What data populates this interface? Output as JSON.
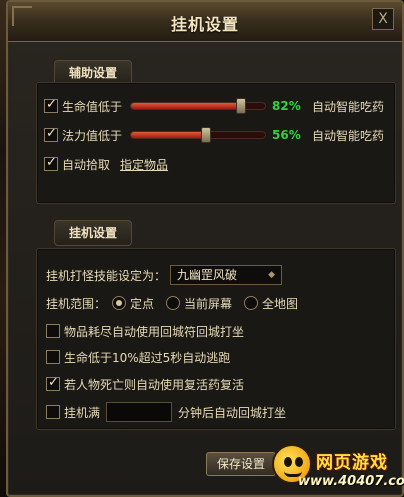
{
  "window": {
    "title": "挂机设置",
    "close_label": "X"
  },
  "assist": {
    "section_label": "辅助设置",
    "hp": {
      "label": "生命值低于",
      "checked": true,
      "value_text": "82%",
      "value": 0.82,
      "auto_text": "自动智能吃药"
    },
    "mp": {
      "label": "法力值低于",
      "checked": true,
      "value_text": "56%",
      "value": 0.56,
      "auto_text": "自动智能吃药"
    },
    "pickup": {
      "label": "自动拾取",
      "checked": true,
      "link": "指定物品"
    }
  },
  "hang": {
    "section_label": "挂机设置",
    "skill_label": "挂机打怪技能设定为：",
    "skill_value": "九幽罡风破",
    "range_label": "挂机范围：",
    "range_options": [
      "定点",
      "当前屏幕",
      "全地图"
    ],
    "range_selected": 0,
    "opt1": {
      "label": "物品耗尽自动使用回城符回城打坐",
      "checked": false
    },
    "opt2": {
      "label": "生命低于10%超过5秒自动逃跑",
      "checked": false
    },
    "opt3": {
      "label": "若人物死亡则自动使用复活药复活",
      "checked": true
    },
    "opt4": {
      "label": "挂机满",
      "suffix": "分钟后自动回城打坐",
      "minutes": "",
      "checked": false
    }
  },
  "footer": {
    "save_label": "保存设置"
  },
  "watermark": {
    "title": "网页游戏",
    "url": "www.40407.com"
  },
  "colors": {
    "accent_green": "#32d43c",
    "frame": "#6b5a3c",
    "slider_red": "#c02a18"
  }
}
